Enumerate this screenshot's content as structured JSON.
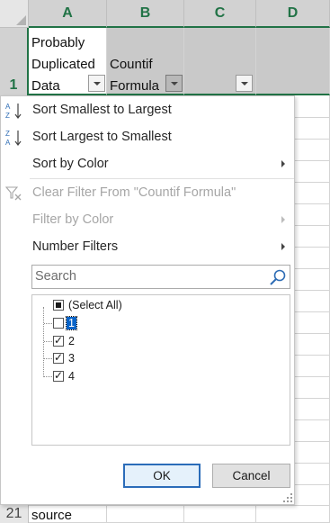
{
  "spreadsheet": {
    "columns": [
      "A",
      "B",
      "C",
      "D"
    ],
    "row_numbers": {
      "header_row": "1",
      "bottom_row": "21"
    },
    "header_cells": {
      "a_text": [
        "Probably",
        "Duplicated",
        "Data"
      ],
      "b_text": [
        "Countif",
        "Formula"
      ]
    },
    "bottom_cell_a": "source"
  },
  "filter_menu": {
    "sort_asc_label": "Sort Smallest to Largest",
    "sort_desc_label": "Sort Largest to Smallest",
    "sort_by_color_label": "Sort by Color",
    "clear_filter_label": "Clear Filter From \"Countif Formula\"",
    "filter_by_color_label": "Filter by Color",
    "number_filters_label": "Number Filters",
    "search_placeholder": "Search",
    "items": [
      {
        "label": "(Select All)",
        "state": "indeterminate"
      },
      {
        "label": "1",
        "state": "unchecked"
      },
      {
        "label": "2",
        "state": "checked"
      },
      {
        "label": "3",
        "state": "checked"
      },
      {
        "label": "4",
        "state": "checked"
      }
    ],
    "ok_label": "OK",
    "cancel_label": "Cancel"
  },
  "icons": {
    "sort_asc": "sort-ascending-icon",
    "sort_desc": "sort-descending-icon",
    "clear_filter": "clear-filter-icon",
    "search": "search-icon",
    "submenu": "chevron-right-icon",
    "dropdown": "dropdown-arrow-icon"
  },
  "colors": {
    "selected_header_accent": "#217346",
    "filled_header_cell": "#c9c9c9",
    "default_button_border": "#2b6cb9",
    "sort_icon_blue": "#2f6db5"
  }
}
